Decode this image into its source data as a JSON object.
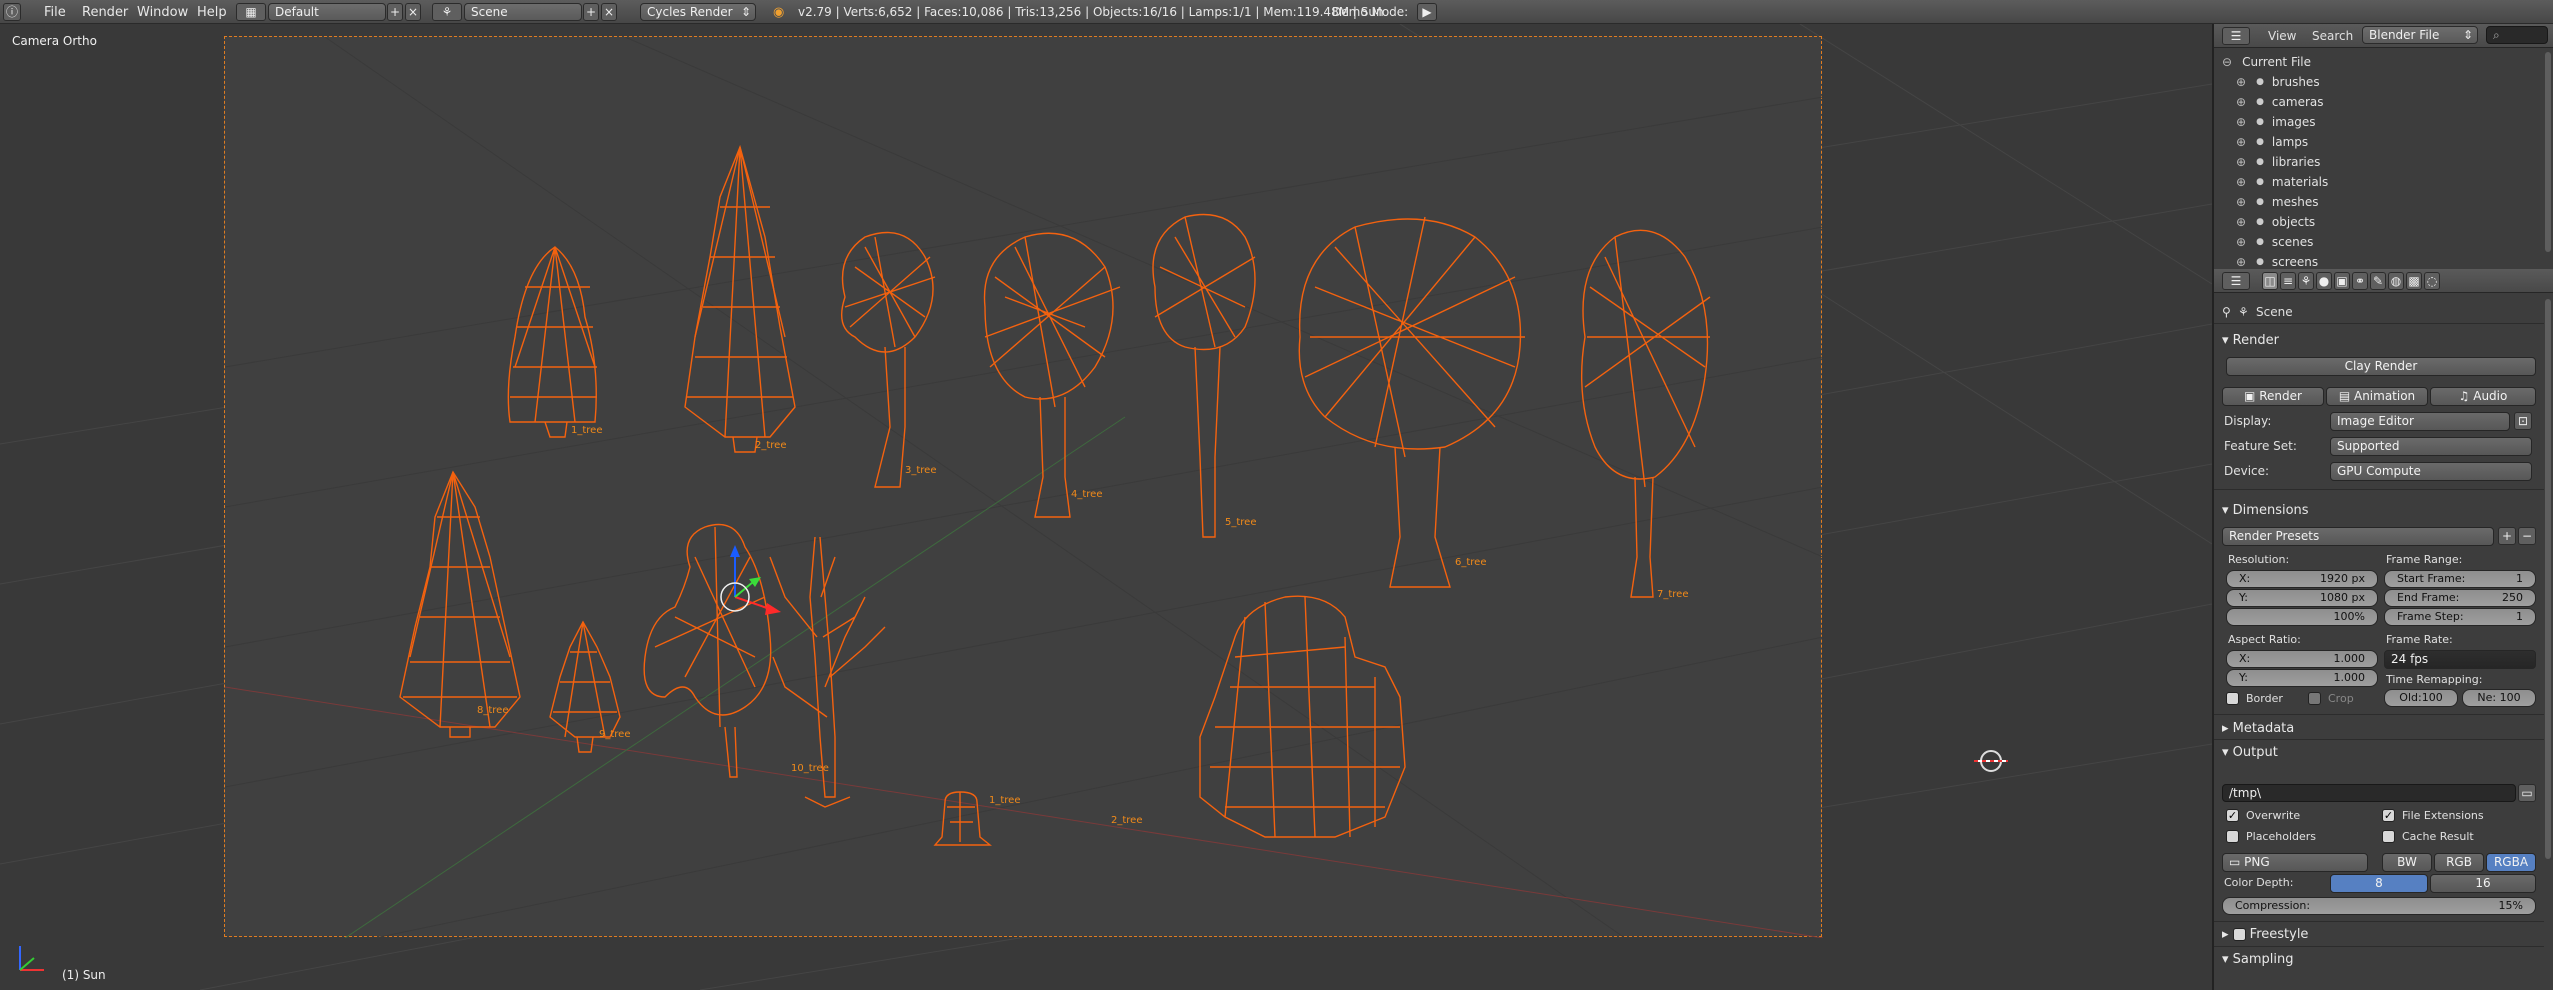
{
  "topbar": {
    "menus": [
      "File",
      "Render",
      "Window",
      "Help"
    ],
    "layout": "Default",
    "scene": "Scene",
    "engine": "Cycles Render",
    "stats": "v2.79 | Verts:6,652 | Faces:10,086 | Tris:13,256 | Objects:16/16 | Lamps:1/1 | Mem:119.48M | Sun",
    "demo_mode": "Demo Mode:"
  },
  "viewport": {
    "title": "Camera Ortho",
    "status": "(1) Sun",
    "labels": [
      "1_tree",
      "2_tree",
      "3_tree",
      "4_tree",
      "5_tree",
      "6_tree",
      "7_tree",
      "8_tree",
      "9_tree",
      "10_tree",
      "1_tree",
      "2_tree"
    ],
    "wire_color": "#f4620f",
    "frame_color": "#e07c20"
  },
  "outliner": {
    "view": "View",
    "search": "Search",
    "mode": "Blender File",
    "root": "Current File",
    "items": [
      "brushes",
      "cameras",
      "images",
      "lamps",
      "libraries",
      "materials",
      "meshes",
      "objects",
      "scenes",
      "screens"
    ]
  },
  "properties": {
    "context": "Scene",
    "render": {
      "title": "Render",
      "clay": "Clay Render",
      "tabs": [
        "Render",
        "Animation",
        "Audio"
      ],
      "display_label": "Display:",
      "display": "Image Editor",
      "feature_label": "Feature Set:",
      "feature": "Supported",
      "device_label": "Device:",
      "device": "GPU Compute"
    },
    "dimensions": {
      "title": "Dimensions",
      "presets": "Render Presets",
      "resolution": "Resolution:",
      "res_x": {
        "label": "X:",
        "value": "1920 px"
      },
      "res_y": {
        "label": "Y:",
        "value": "1080 px"
      },
      "res_pct": "100%",
      "frame_range": "Frame Range:",
      "start": {
        "label": "Start Frame:",
        "value": "1"
      },
      "end": {
        "label": "End Frame:",
        "value": "250"
      },
      "step": {
        "label": "Frame Step:",
        "value": "1"
      },
      "aspect": "Aspect Ratio:",
      "asp_x": {
        "label": "X:",
        "value": "1.000"
      },
      "asp_y": {
        "label": "Y:",
        "value": "1.000"
      },
      "frame_rate": "Frame Rate:",
      "fps": "24 fps",
      "time_remap": "Time Remapping:",
      "old": "Old:100",
      "new": "Ne: 100",
      "border": "Border",
      "crop": "Crop"
    },
    "metadata": "Metadata",
    "output": {
      "title": "Output",
      "path": "/tmp\\",
      "overwrite": "Overwrite",
      "file_ext": "File Extensions",
      "placeholders": "Placeholders",
      "cache": "Cache Result",
      "format": "PNG",
      "modes": [
        "BW",
        "RGB",
        "RGBA"
      ],
      "depth_label": "Color Depth:",
      "depths": [
        "8",
        "16"
      ],
      "compression": "Compression:",
      "compression_val": "15%"
    },
    "freestyle": "Freestyle",
    "sampling": "Sampling"
  }
}
